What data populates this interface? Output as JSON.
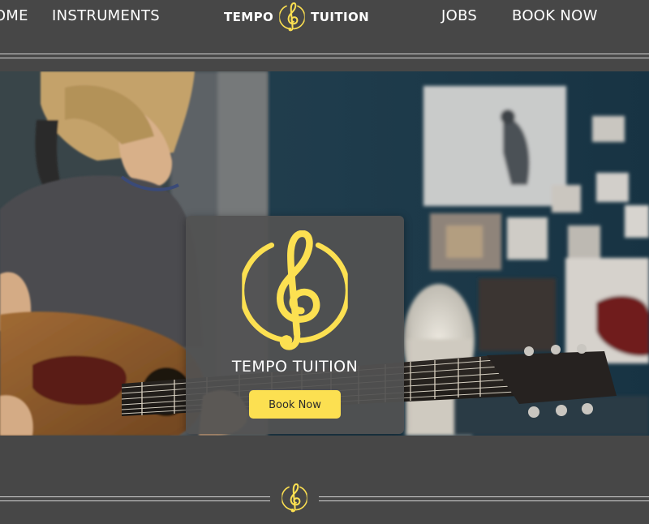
{
  "nav": {
    "home_label": "HOME",
    "instruments_label": "INSTRUMENTS",
    "brand_left": "TEMPO",
    "brand_right": "TUITION",
    "jobs_label": "JOBS",
    "book_label": "BOOK NOW"
  },
  "hero": {
    "title": "TEMPO TUITION",
    "button_label": "Book Now"
  },
  "icons": {
    "logo": "treble-clef-icon",
    "footer_logo": "treble-clef-icon"
  },
  "colors": {
    "accent": "#fce051",
    "background": "#474747",
    "card": "#525252",
    "text": "#ffffff"
  }
}
